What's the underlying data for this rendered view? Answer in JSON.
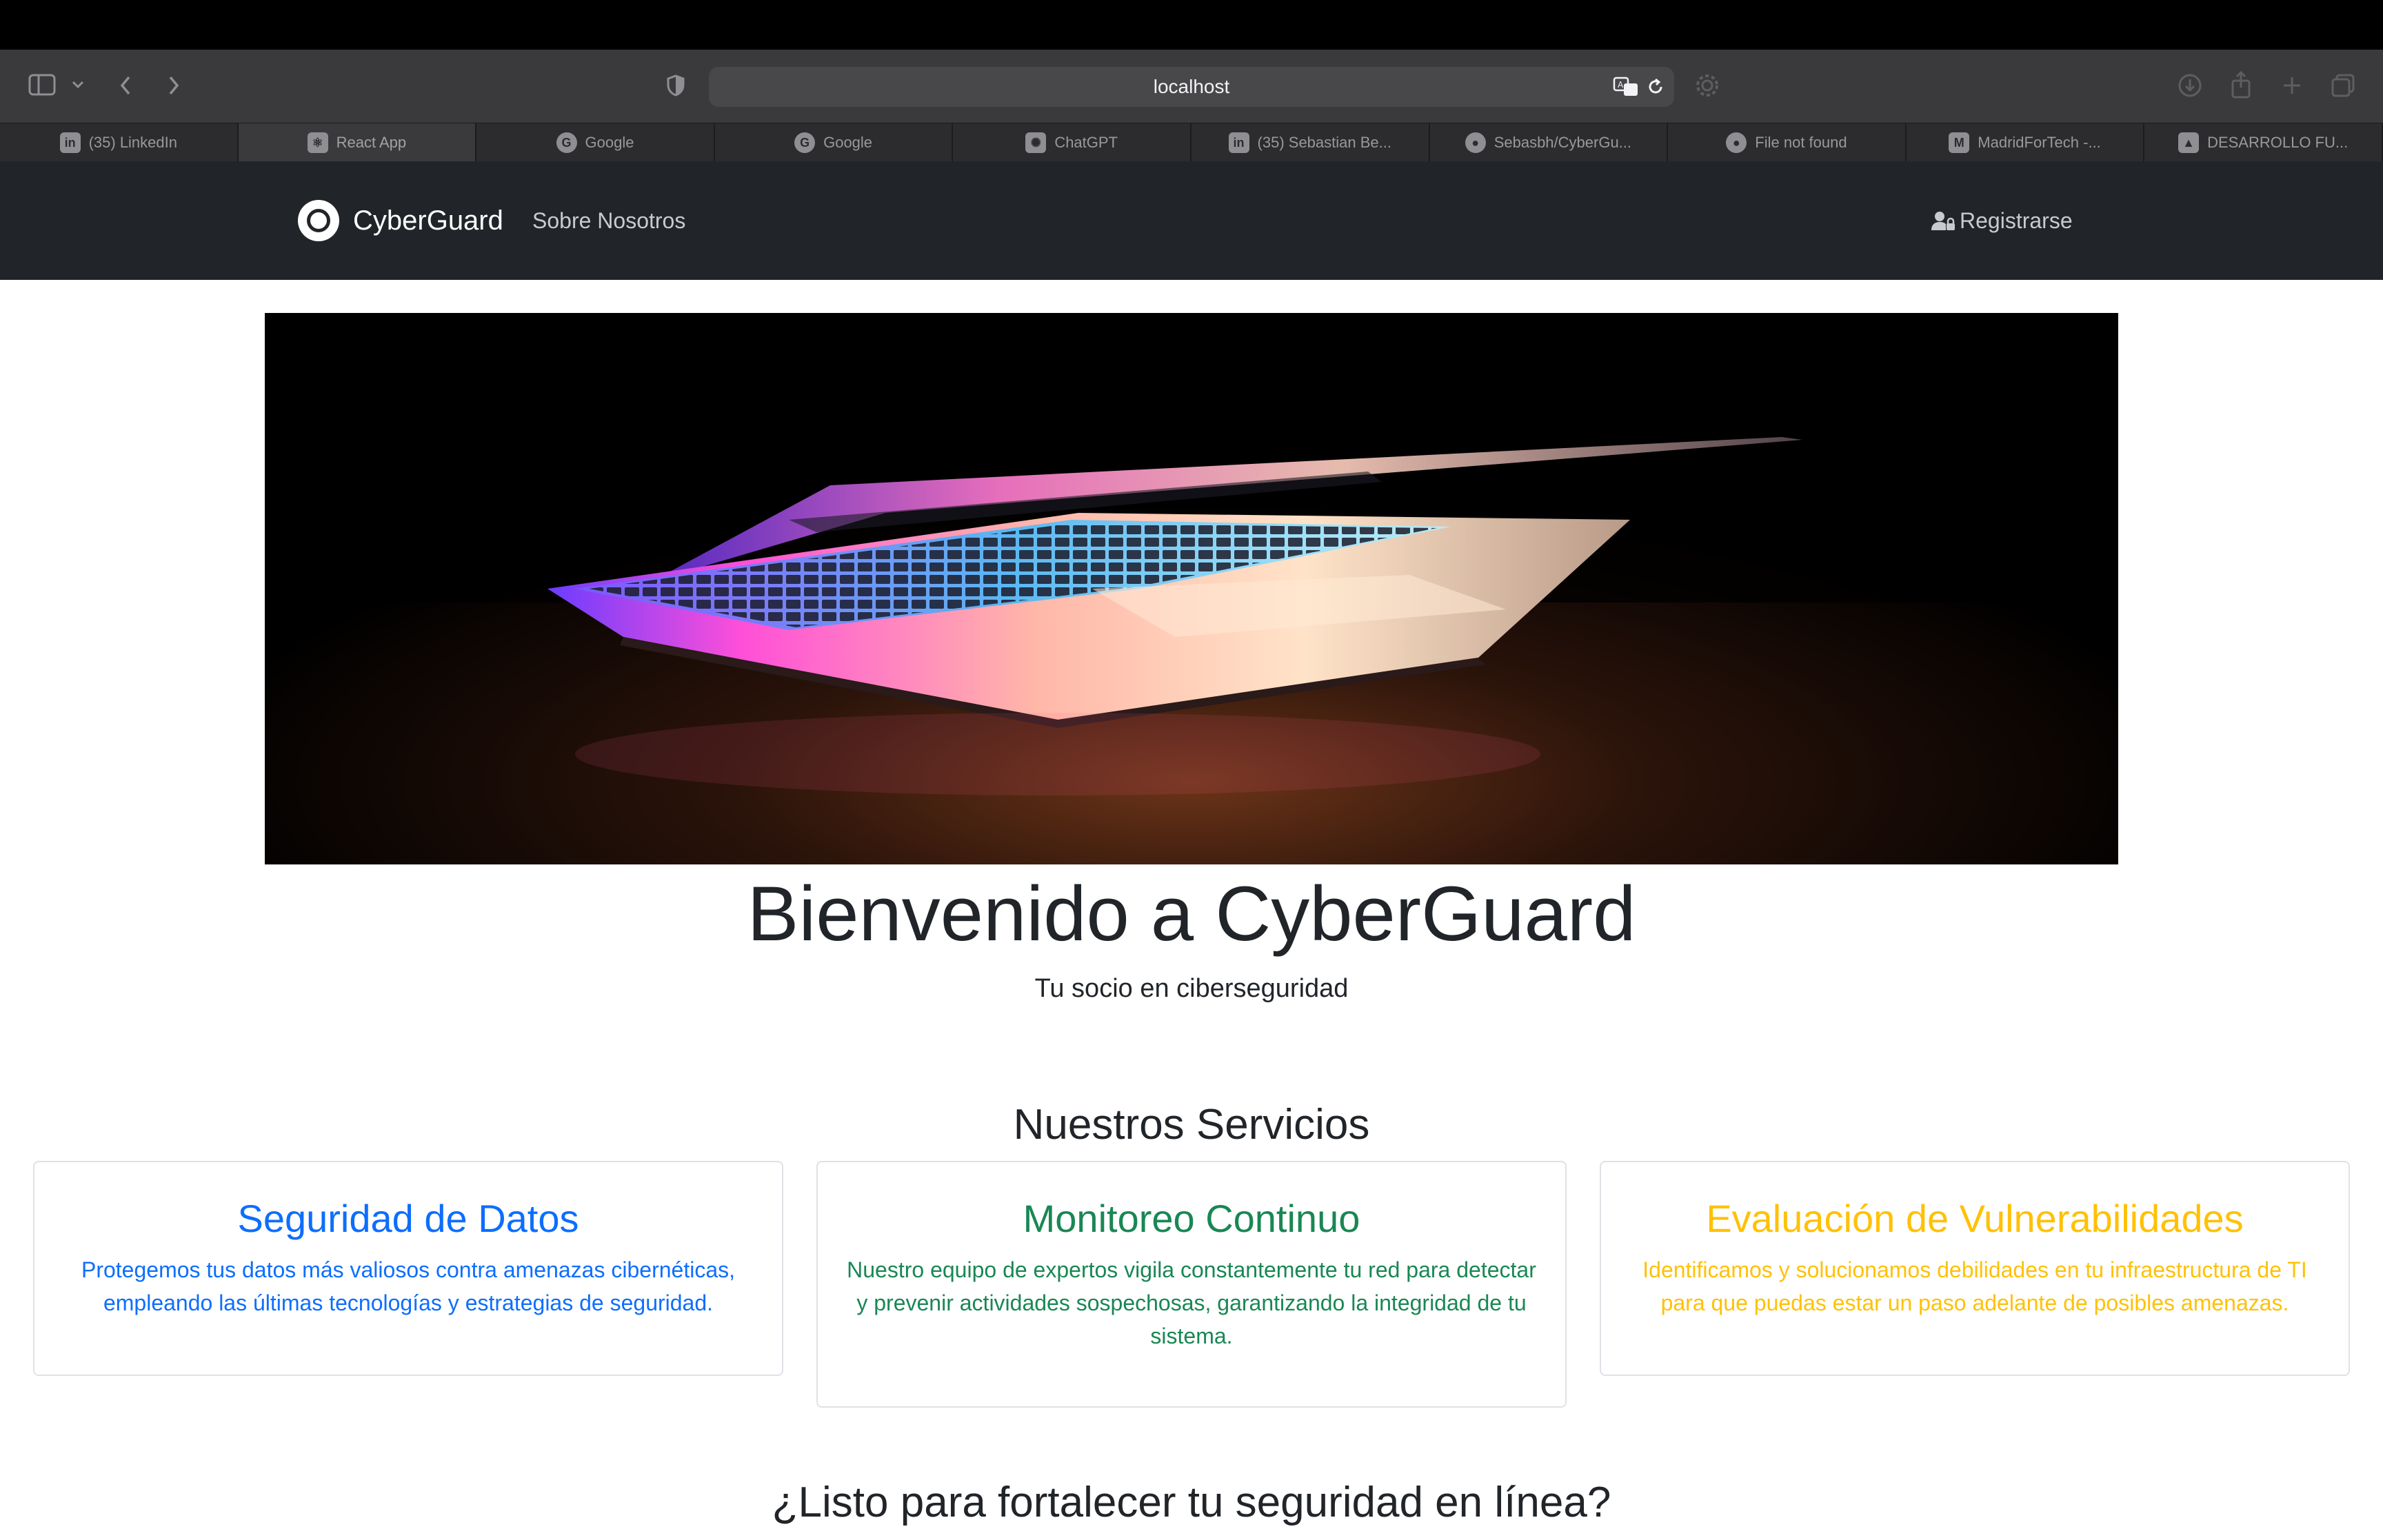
{
  "browser": {
    "url": "localhost",
    "tabs": [
      {
        "label": "(35) LinkedIn",
        "favicon": "linkedin-icon",
        "fav_text": "in",
        "active": false
      },
      {
        "label": "React App",
        "favicon": "react-icon",
        "fav_text": "⚛",
        "active": true
      },
      {
        "label": "Google",
        "favicon": "google-icon",
        "fav_text": "G",
        "active": false
      },
      {
        "label": "Google",
        "favicon": "google-icon",
        "fav_text": "G",
        "active": false
      },
      {
        "label": "ChatGPT",
        "favicon": "chatgpt-icon",
        "fav_text": "✺",
        "active": false
      },
      {
        "label": "(35) Sebastian Be...",
        "favicon": "linkedin-icon",
        "fav_text": "in",
        "active": false
      },
      {
        "label": "Sebasbh/CyberGu...",
        "favicon": "github-icon",
        "fav_text": "●",
        "active": false
      },
      {
        "label": "File not found",
        "favicon": "github-icon",
        "fav_text": "●",
        "active": false
      },
      {
        "label": "MadridForTech -...",
        "favicon": "madridfortech-icon",
        "fav_text": "M",
        "active": false
      },
      {
        "label": "DESARROLLO FU...",
        "favicon": "drive-icon",
        "fav_text": "▲",
        "active": false
      }
    ]
  },
  "navbar": {
    "brand": "CyberGuard",
    "links": [
      "Sobre Nosotros"
    ],
    "register_label": "Registrarse"
  },
  "hero": {
    "image": "laptop-keyboard-glow-image",
    "title": "Bienvenido a CyberGuard",
    "subtitle": "Tu socio en ciberseguridad"
  },
  "services": {
    "title": "Nuestros Servicios",
    "cards": [
      {
        "title": "Seguridad de Datos",
        "text": "Protegemos tus datos más valiosos contra amenazas cibernéticas, empleando las últimas tecnologías y estrategias de seguridad.",
        "color": "#0d6efd"
      },
      {
        "title": "Monitoreo Continuo",
        "text": "Nuestro equipo de expertos vigila constantemente tu red para detectar y prevenir actividades sospechosas, garantizando la integridad de tu sistema.",
        "color": "#198754"
      },
      {
        "title": "Evaluación de Vulnerabilidades",
        "text": "Identificamos y solucionamos debilidades en tu infraestructura de TI para que puedas estar un paso adelante de posibles amenazas.",
        "color": "#ffc107"
      }
    ]
  },
  "cta": {
    "title": "¿Listo para fortalecer tu seguridad en línea?"
  }
}
